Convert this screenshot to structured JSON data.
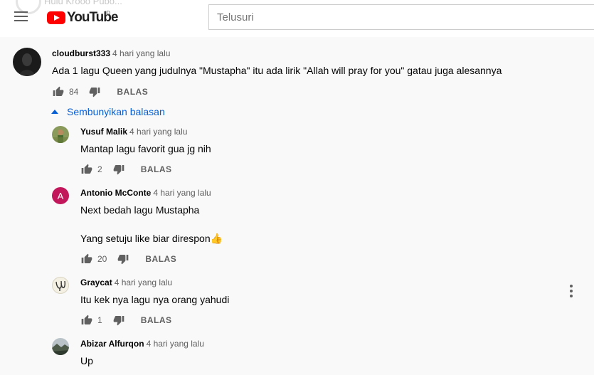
{
  "header": {
    "ghost_text": "Hulu Krooo Pubo...",
    "logo_text": "YouTube",
    "country_code": "ID",
    "search_placeholder": "Telusuri"
  },
  "toggle_replies_label": "Sembunyikan balasan",
  "comments": [
    {
      "author": "cloudburst333",
      "time": "4 hari yang lalu",
      "text_lines": [
        "Ada 1 lagu Queen yang judulnya \"Mustapha\" itu ada lirik \"Allah will pray for you\" gatau juga alesannya"
      ],
      "likes": "84",
      "reply_label": "BALAS"
    }
  ],
  "replies": [
    {
      "author": "Yusuf Malik",
      "time": "4 hari yang lalu",
      "text_lines": [
        "Mantap lagu favorit gua jg nih"
      ],
      "likes": "2",
      "reply_label": "BALAS"
    },
    {
      "author": "Antonio McConte",
      "time": "4 hari yang lalu",
      "avatar_letter": "A",
      "avatar_color": "#c2185b",
      "text_lines": [
        "Next bedah lagu Mustapha",
        "Yang setuju like biar direspon👍"
      ],
      "likes": "20",
      "reply_label": "BALAS"
    },
    {
      "author": "Graycat",
      "time": "4 hari yang lalu",
      "text_lines": [
        "Itu kek nya lagu nya orang yahudi"
      ],
      "likes": "1",
      "reply_label": "BALAS"
    },
    {
      "author": "Abizar Alfurqon",
      "time": "4 hari yang lalu",
      "text_lines": [
        "Up"
      ]
    }
  ],
  "icons": {
    "menu": "hamburger-menu-icon",
    "like": "thumbs-up-icon",
    "dislike": "thumbs-down-icon",
    "collapse": "caret-up-icon",
    "more": "vertical-ellipsis-icon"
  },
  "colors": {
    "link_blue": "#065fd4",
    "brand_red": "#ff0000",
    "muted_text": "#606060"
  }
}
